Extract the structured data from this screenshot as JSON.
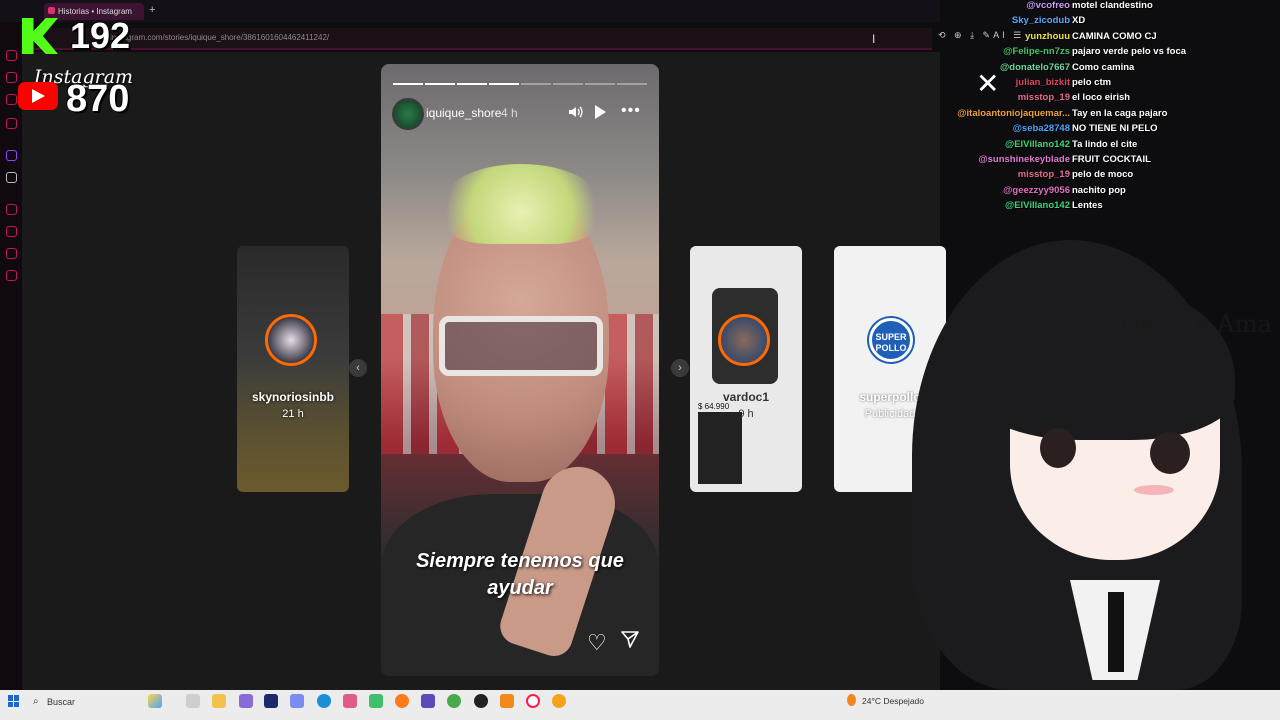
{
  "browser": {
    "tab_title": "Historias • Instagram",
    "new_tab": "+",
    "url": "instagram.com/stories/iquique_shore/3861601604462411242/",
    "tools": "⟲ ⊕ ⤓ ✎AI ☰"
  },
  "overlay": {
    "kick_count": "192",
    "instagram_label": "Instagram",
    "youtube_count": "870"
  },
  "story": {
    "username": "iquique_shore",
    "time": "4 h",
    "caption_line1": "Siempre  tenemos que",
    "caption_line2": "ayudar",
    "close_label": "✕",
    "more_label": "•••",
    "progress_total": 8,
    "progress_done": 4
  },
  "side_stories": [
    {
      "username": "skynoriosinbb",
      "time": "21 h"
    },
    {
      "username": "vardoc1",
      "time": "9 h",
      "price": "$ 64.990"
    },
    {
      "username": "superpollo",
      "time": "Publicidad",
      "logo_text_1": "SUPER",
      "logo_text_2": "POLLO"
    }
  ],
  "chat": [
    {
      "user": "@vcofreo",
      "message": "motel clandestino",
      "color": "#c99cff"
    },
    {
      "user": "Sky_zicodub",
      "message": "XD",
      "color": "#5aa9ff"
    },
    {
      "user": "yunzhouu",
      "message": "CAMINA COMO CJ",
      "color": "#f0e24a"
    },
    {
      "user": "@Felipe-nn7zs",
      "message": "pajaro verde pelo vs foca",
      "color": "#44c767"
    },
    {
      "user": "@donatelo7667",
      "message": "Como camina",
      "color": "#6fd6a0"
    },
    {
      "user": "julian_bizkit",
      "message": "pelo ctm",
      "color": "#e2445c"
    },
    {
      "user": "misstop_19",
      "message": "el loco eirish",
      "color": "#e56b8e"
    },
    {
      "user": "@italoantoniojaquemar...",
      "message": "Tay en la caga pajaro",
      "color": "#f0a040"
    },
    {
      "user": "@seba28748",
      "message": "NO TIENE NI PELO",
      "color": "#4aa3ff"
    },
    {
      "user": "@ElVillano142",
      "message": "Ta lindo el cite",
      "color": "#3bd67a"
    },
    {
      "user": "@sunshinekeyblade",
      "message": "FRUIT COCKTAIL",
      "color": "#e07ad0"
    },
    {
      "user": "misstop_19",
      "message": "pelo de moco",
      "color": "#e56b8e"
    },
    {
      "user": "@geezzyy9056",
      "message": "nachito pop",
      "color": "#e070c0"
    },
    {
      "user": "@ElVillano142",
      "message": "Lentes",
      "color": "#3bd67a"
    }
  ],
  "vtuber": {
    "watermark": "Dios Te Ama"
  },
  "taskbar": {
    "search_placeholder": "Buscar",
    "weather": "24°C  Despejado"
  },
  "colors": {
    "kick_green": "#53fc18",
    "youtube_red": "#ff0000",
    "instagram_pink": "#e1306c"
  }
}
